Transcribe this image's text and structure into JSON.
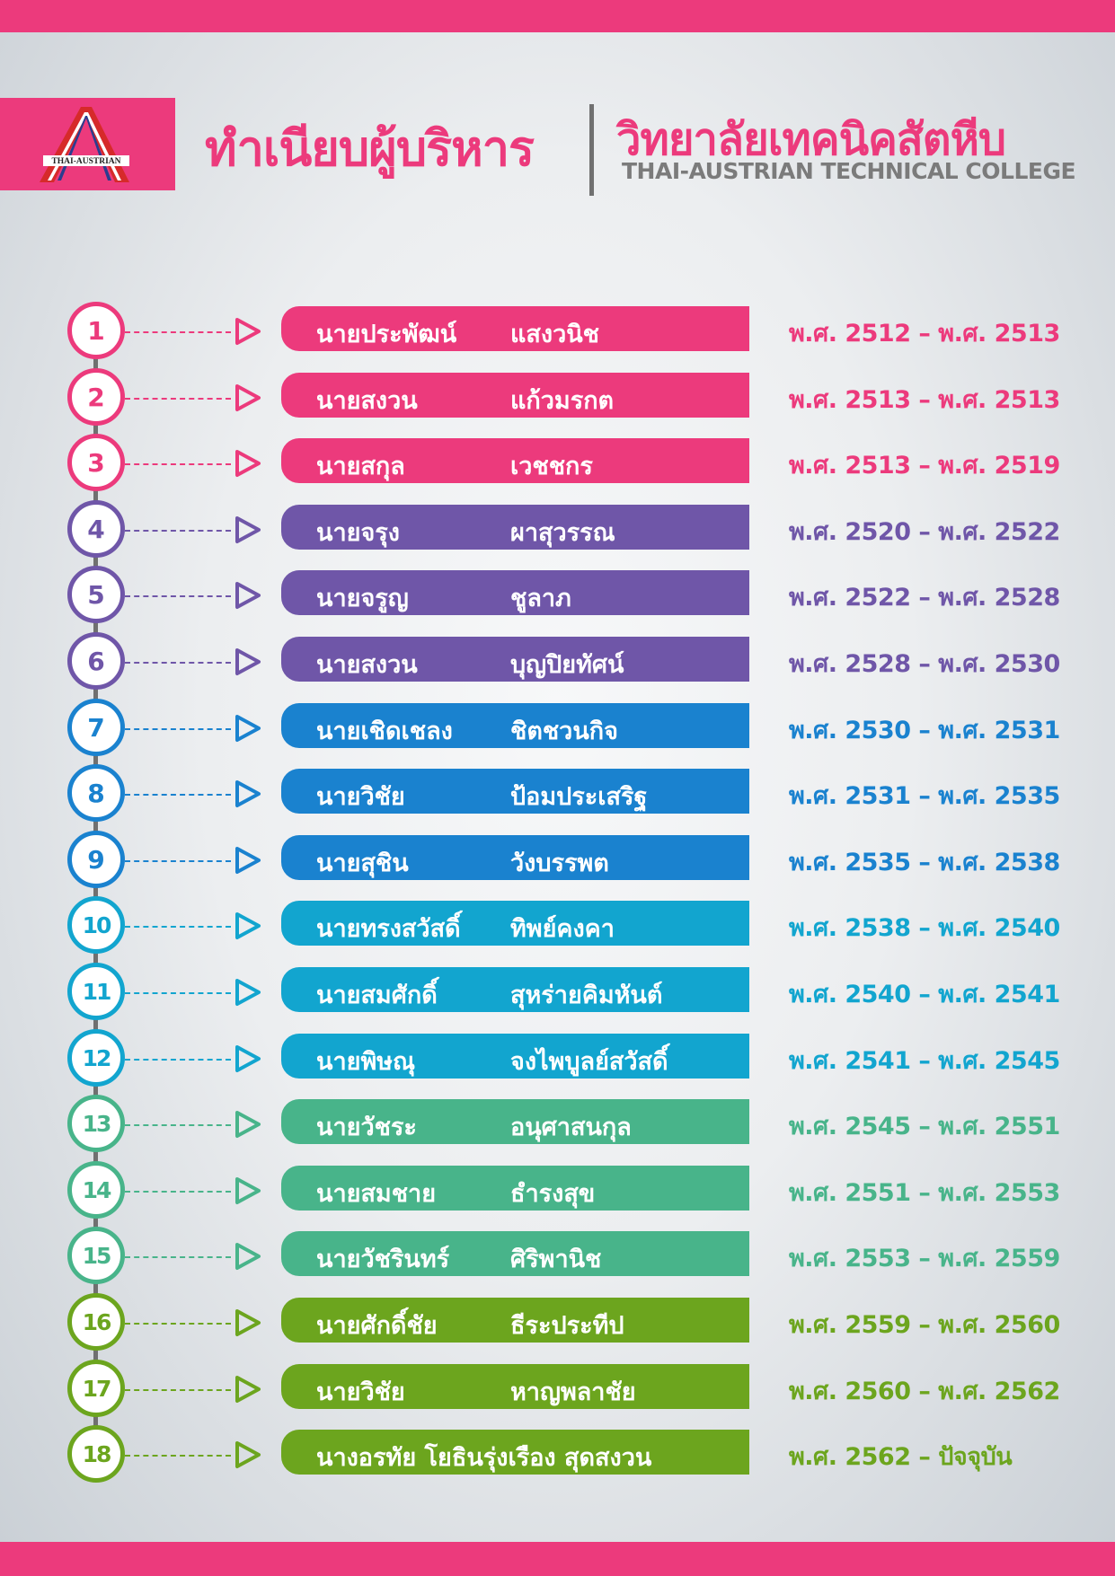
{
  "header": {
    "title": "ทำเนียบผู้บริหาร",
    "college_th": "วิทยาลัยเทคนิคสัตหีบ",
    "college_en": "THAI-AUSTRIAN TECHNICAL COLLEGE",
    "logo_text": "THAI-AUSTRIAN"
  },
  "colors": {
    "pink": "#ec3a7c",
    "purple": "#6f56a8",
    "blue": "#1a82cf",
    "cyan": "#12a5cf",
    "teal": "#48b48a",
    "green": "#6ca51e",
    "divider_gray": "#707070"
  },
  "administrators": [
    {
      "number": "1",
      "first_name": "นายประพัฒน์",
      "last_name": "แสงวนิช",
      "period": "พ.ศ. 2512 – พ.ศ. 2513",
      "color": "#ec3a7c"
    },
    {
      "number": "2",
      "first_name": "นายสงวน",
      "last_name": "แก้วมรกต",
      "period": "พ.ศ. 2513 – พ.ศ. 2513",
      "color": "#ec3a7c"
    },
    {
      "number": "3",
      "first_name": "นายสกุล",
      "last_name": "เวชชกร",
      "period": "พ.ศ. 2513 – พ.ศ. 2519",
      "color": "#ec3a7c"
    },
    {
      "number": "4",
      "first_name": "นายจรุง",
      "last_name": "ผาสุวรรณ",
      "period": "พ.ศ. 2520 – พ.ศ. 2522",
      "color": "#6f56a8"
    },
    {
      "number": "5",
      "first_name": "นายจรูญ",
      "last_name": "ชูลาภ",
      "period": "พ.ศ. 2522 – พ.ศ. 2528",
      "color": "#6f56a8"
    },
    {
      "number": "6",
      "first_name": "นายสงวน",
      "last_name": "บุญปิยทัศน์",
      "period": "พ.ศ. 2528 – พ.ศ. 2530",
      "color": "#6f56a8"
    },
    {
      "number": "7",
      "first_name": "นายเชิดเชลง",
      "last_name": "ชิตชวนกิจ",
      "period": "พ.ศ. 2530 – พ.ศ. 2531",
      "color": "#1a82cf"
    },
    {
      "number": "8",
      "first_name": "นายวิชัย",
      "last_name": "ป้อมประเสริฐ",
      "period": "พ.ศ. 2531 – พ.ศ. 2535",
      "color": "#1a82cf"
    },
    {
      "number": "9",
      "first_name": "นายสุชิน",
      "last_name": "วังบรรพต",
      "period": "พ.ศ. 2535 – พ.ศ. 2538",
      "color": "#1a82cf"
    },
    {
      "number": "10",
      "first_name": "นายทรงสวัสดิ์",
      "last_name": "ทิพย์คงคา",
      "period": "พ.ศ. 2538 – พ.ศ. 2540",
      "color": "#12a5cf"
    },
    {
      "number": "11",
      "first_name": "นายสมศักดิ์",
      "last_name": "สุหร่ายคิมหันต์",
      "period": "พ.ศ. 2540 – พ.ศ. 2541",
      "color": "#12a5cf"
    },
    {
      "number": "12",
      "first_name": "นายพิษณุ",
      "last_name": "จงไพบูลย์สวัสดิ์",
      "period": "พ.ศ. 2541 – พ.ศ. 2545",
      "color": "#12a5cf"
    },
    {
      "number": "13",
      "first_name": "นายวัชระ",
      "last_name": "อนุศาสนกุล",
      "period": "พ.ศ. 2545 – พ.ศ. 2551",
      "color": "#48b48a"
    },
    {
      "number": "14",
      "first_name": "นายสมชาย",
      "last_name": "ธำรงสุข",
      "period": "พ.ศ. 2551 – พ.ศ. 2553",
      "color": "#48b48a"
    },
    {
      "number": "15",
      "first_name": "นายวัชรินทร์",
      "last_name": "ศิริพานิช",
      "period": "พ.ศ. 2553 – พ.ศ. 2559",
      "color": "#48b48a"
    },
    {
      "number": "16",
      "first_name": "นายศักดิ์ชัย",
      "last_name": "ธีระประทีป",
      "period": "พ.ศ. 2559 – พ.ศ. 2560",
      "color": "#6ca51e"
    },
    {
      "number": "17",
      "first_name": "นายวิชัย",
      "last_name": "หาญพลาชัย",
      "period": "พ.ศ. 2560 – พ.ศ. 2562",
      "color": "#6ca51e"
    },
    {
      "number": "18",
      "full_name": "นางอรทัย โยธินรุ่งเรือง สุดสงวน",
      "period": "พ.ศ. 2562 – ปัจจุบัน",
      "color": "#6ca51e"
    }
  ]
}
